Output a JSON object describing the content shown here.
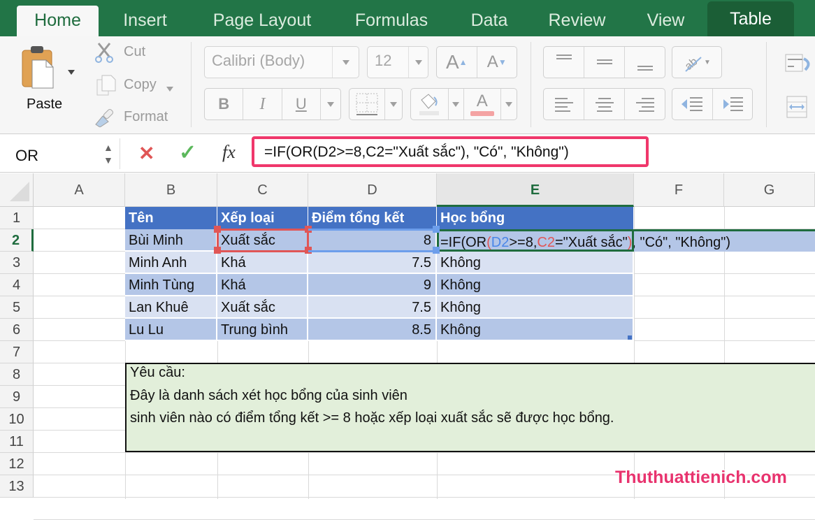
{
  "ribbon": {
    "tabs": [
      "Home",
      "Insert",
      "Page Layout",
      "Formulas",
      "Data",
      "Review",
      "View",
      "Table"
    ],
    "active_tab": "Home",
    "clipboard": {
      "paste": "Paste",
      "cut": "Cut",
      "copy": "Copy",
      "format": "Format"
    },
    "font": {
      "name": "Calibri (Body)",
      "size": "12",
      "bold": "B",
      "italic": "I",
      "underline": "U",
      "grow": "A",
      "shrink": "A",
      "font_color": "A"
    },
    "colors": {
      "accent_green": "#227547",
      "font_color_bar": "#f4a3a3"
    }
  },
  "formula_bar": {
    "name_box": "OR",
    "cancel_icon": "✕",
    "enter_icon": "✓",
    "fx_label": "fx",
    "formula": "=IF(OR(D2>=8,C2=\"Xuất sắc\"), \"Có\", \"Không\")",
    "highlight_color": "#f0376b"
  },
  "grid": {
    "columns": [
      "A",
      "B",
      "C",
      "D",
      "E",
      "F",
      "G"
    ],
    "selected_column": "E",
    "rows": [
      "1",
      "2",
      "3",
      "4",
      "5",
      "6",
      "7",
      "8",
      "9",
      "10",
      "11",
      "12",
      "13"
    ],
    "selected_row": "2",
    "table": {
      "headers": [
        "Tên",
        "Xếp loại",
        "Điểm tổng kết",
        "Học bổng"
      ],
      "rows": [
        [
          "Bùi Minh",
          "Xuất sắc",
          "8",
          ""
        ],
        [
          "Minh Anh",
          "Khá",
          "7.5",
          "Không"
        ],
        [
          "Minh Tùng",
          "Khá",
          "9",
          "Không"
        ],
        [
          "Lan Khuê",
          "Xuất sắc",
          "7.5",
          "Không"
        ],
        [
          "Lu Lu",
          "Trung bình",
          "8.5",
          "Không"
        ]
      ],
      "editing_cell": "E2",
      "editing_formula_parts": {
        "p1": "=IF(OR",
        "p2": "(",
        "p3": "D2",
        "p4": ">=8,",
        "p5": "C2",
        "p6": "=\"Xuất sắc\"",
        "p7": ")",
        "p8": ", \"Có\", \"Không\")"
      }
    },
    "note": {
      "lines": [
        "Yêu cầu:",
        "Đây là danh sách xét học bổng của sinh viên",
        "sinh viên nào có điểm tổng kết >= 8 hoặc xếp loại xuất sắc sẽ được học bổng."
      ]
    }
  },
  "watermark": "Thuthuattienich.com"
}
